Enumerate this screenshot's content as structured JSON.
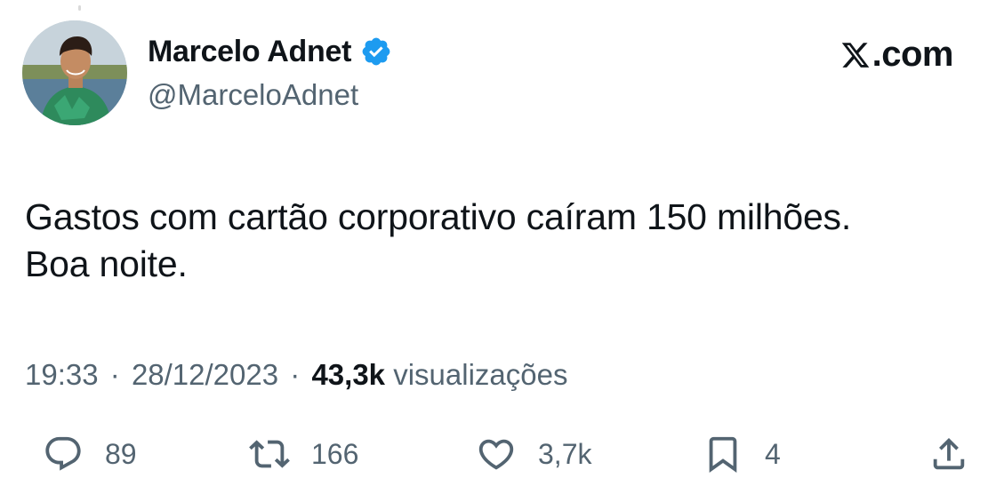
{
  "author": {
    "display_name": "Marcelo Adnet",
    "handle": "@MarceloAdnet",
    "verified": true,
    "avatar_icon": "profile-photo"
  },
  "brand": {
    "text": ".com",
    "logo_icon": "x-logo-icon"
  },
  "tweet": {
    "lines": [
      "Gastos com cartão corporativo caíram 150 milhões.",
      "Boa noite."
    ]
  },
  "meta": {
    "time": "19:33",
    "separator": "·",
    "date": "28/12/2023",
    "views_count": "43,3k",
    "views_label": "visualizações"
  },
  "actions": {
    "reply": {
      "icon": "reply-icon",
      "count": "89"
    },
    "retweet": {
      "icon": "retweet-icon",
      "count": "166"
    },
    "like": {
      "icon": "heart-icon",
      "count": "3,7k"
    },
    "bookmark": {
      "icon": "bookmark-icon",
      "count": "4"
    },
    "share": {
      "icon": "share-icon"
    }
  },
  "colors": {
    "text_primary": "#0f1419",
    "text_secondary": "#536471",
    "verified_blue": "#1d9bf0",
    "background": "#ffffff"
  }
}
